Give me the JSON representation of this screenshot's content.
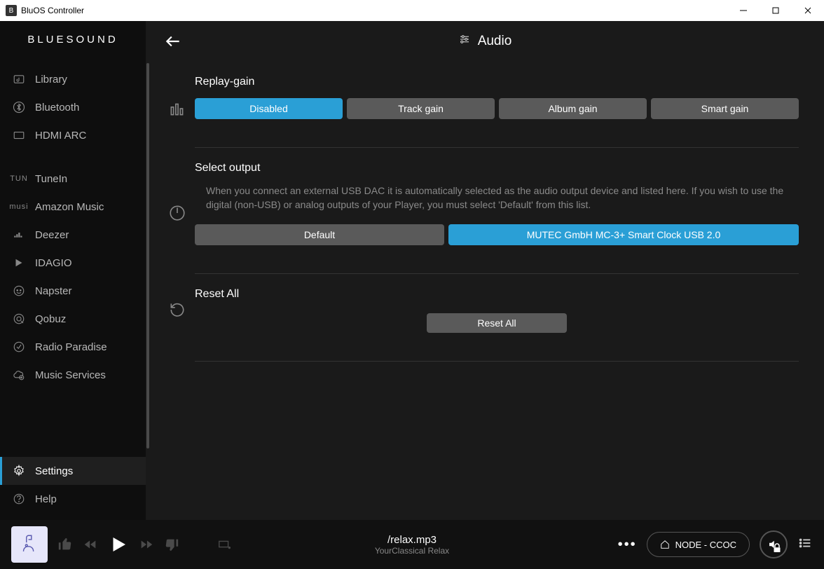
{
  "titlebar": {
    "title": "BluOS Controller"
  },
  "logo": "BLUESOUND",
  "sidebar": {
    "group1": [
      {
        "label": "Library"
      },
      {
        "label": "Bluetooth"
      },
      {
        "label": "HDMI ARC"
      }
    ],
    "group2": [
      {
        "label": "TuneIn"
      },
      {
        "label": "Amazon Music"
      },
      {
        "label": "Deezer"
      },
      {
        "label": "IDAGIO"
      },
      {
        "label": "Napster"
      },
      {
        "label": "Qobuz"
      },
      {
        "label": "Radio Paradise"
      },
      {
        "label": "Music Services"
      }
    ],
    "bottom": [
      {
        "label": "Settings"
      },
      {
        "label": "Help"
      }
    ]
  },
  "header": {
    "title": "Audio"
  },
  "sections": {
    "replay": {
      "title": "Replay-gain",
      "options": [
        "Disabled",
        "Track gain",
        "Album gain",
        "Smart gain"
      ],
      "selected": 0
    },
    "output": {
      "title": "Select output",
      "desc": "When you connect an external USB DAC it is automatically selected as the audio output device and listed here. If you wish to use the digital (non-USB) or analog outputs of your Player, you must select 'Default' from this list.",
      "options": [
        "Default",
        "MUTEC GmbH MC-3+ Smart Clock USB 2.0"
      ],
      "selected": 1
    },
    "reset": {
      "title": "Reset All",
      "button": "Reset All"
    }
  },
  "footer": {
    "track_title": "/relax.mp3",
    "track_sub": "YourClassical Relax",
    "device": "NODE - CCOC"
  }
}
